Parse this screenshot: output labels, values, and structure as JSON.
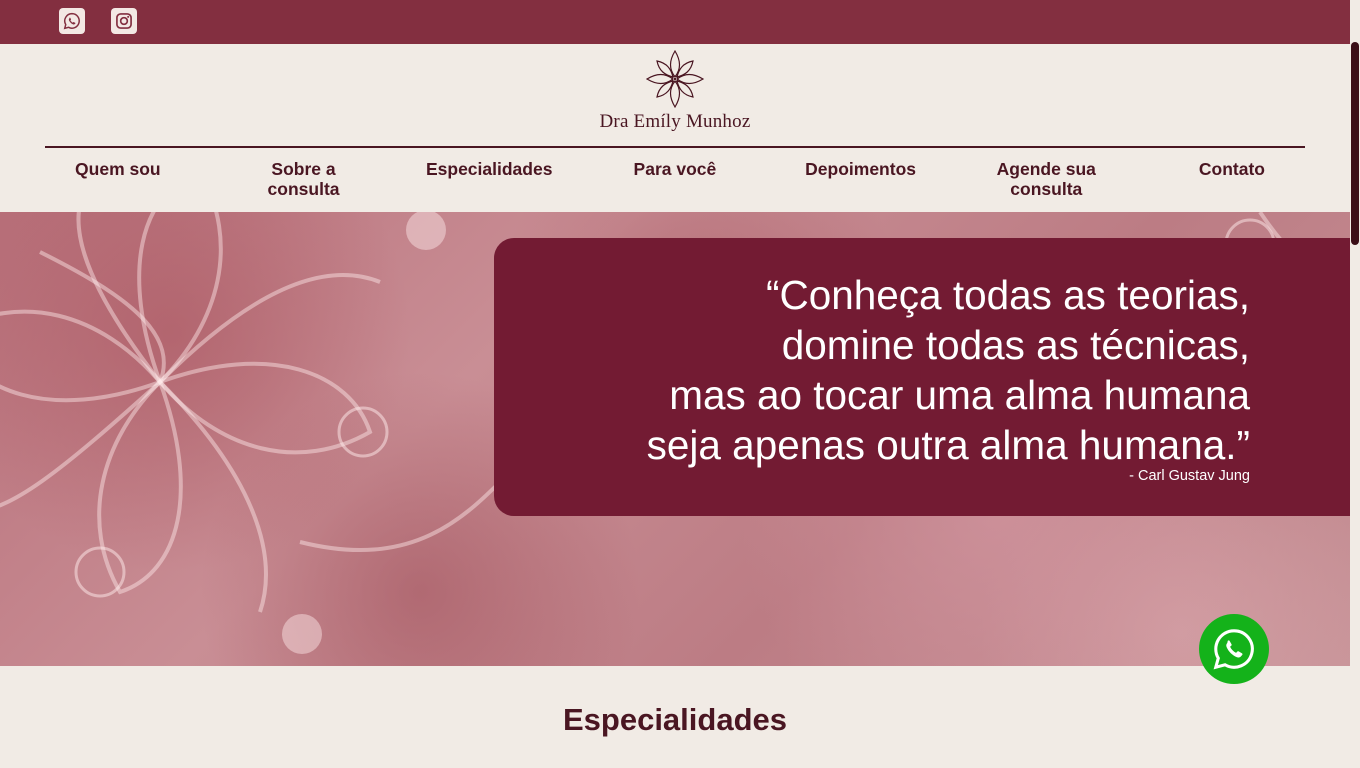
{
  "topbar": {
    "social_icons": [
      "whatsapp-icon",
      "instagram-icon"
    ],
    "color": "#832f40"
  },
  "header": {
    "logo_text": "Dra Emíly Munhoz",
    "logo_icon": "mandala-flower-icon",
    "nav": [
      {
        "label": "Quem sou"
      },
      {
        "label": "Sobre a consulta"
      },
      {
        "label": "Especialidades"
      },
      {
        "label": "Para você"
      },
      {
        "label": "Depoimentos"
      },
      {
        "label": "Agende sua consulta"
      },
      {
        "label": "Contato"
      }
    ]
  },
  "hero": {
    "quote_lines": [
      "“Conheça todas as teorias,",
      "domine todas as técnicas,",
      "mas ao tocar uma alma humana",
      "seja apenas outra alma humana.”"
    ],
    "author": "- Carl Gustav Jung",
    "box_color": "#731b33"
  },
  "floating": {
    "whatsapp_icon": "whatsapp-icon",
    "color": "#14b21a"
  },
  "section": {
    "title": "Especialidades"
  },
  "colors": {
    "brand_dark": "#4a1622",
    "background": "#f1ebe5"
  }
}
